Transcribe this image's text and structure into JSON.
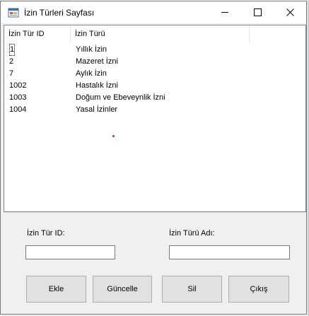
{
  "window": {
    "title": "İzin Türleri Sayfası",
    "controls": {
      "minimize": "minimize",
      "maximize": "maximize",
      "close": "✕"
    }
  },
  "list": {
    "columns": [
      "İzin Tür ID",
      "İzin Türü"
    ],
    "rows": [
      {
        "id": "1",
        "name": "Yıllık İzin"
      },
      {
        "id": "2",
        "name": "Mazeret İzni"
      },
      {
        "id": "7",
        "name": "Aylık İzin"
      },
      {
        "id": "1002",
        "name": "Hastalık İzni"
      },
      {
        "id": "1003",
        "name": "Doğum ve Ebeveynlik İzni"
      },
      {
        "id": "1004",
        "name": "Yasal İzinler"
      }
    ]
  },
  "form": {
    "id_label": "İzin Tür ID:",
    "id_value": "",
    "name_label": "İzin Türü Adı:",
    "name_value": ""
  },
  "buttons": {
    "add": "Ekle",
    "update": "Güncelle",
    "delete": "Sil",
    "exit": "Çıkış"
  },
  "icons": {
    "app": "app-icon",
    "minimize": "minimize-icon",
    "maximize": "maximize-icon",
    "close": "close-icon"
  },
  "colors": {
    "dot": "#d4213a",
    "window_bg": "#f0f0f0",
    "button_bg": "#e1e1e1"
  }
}
